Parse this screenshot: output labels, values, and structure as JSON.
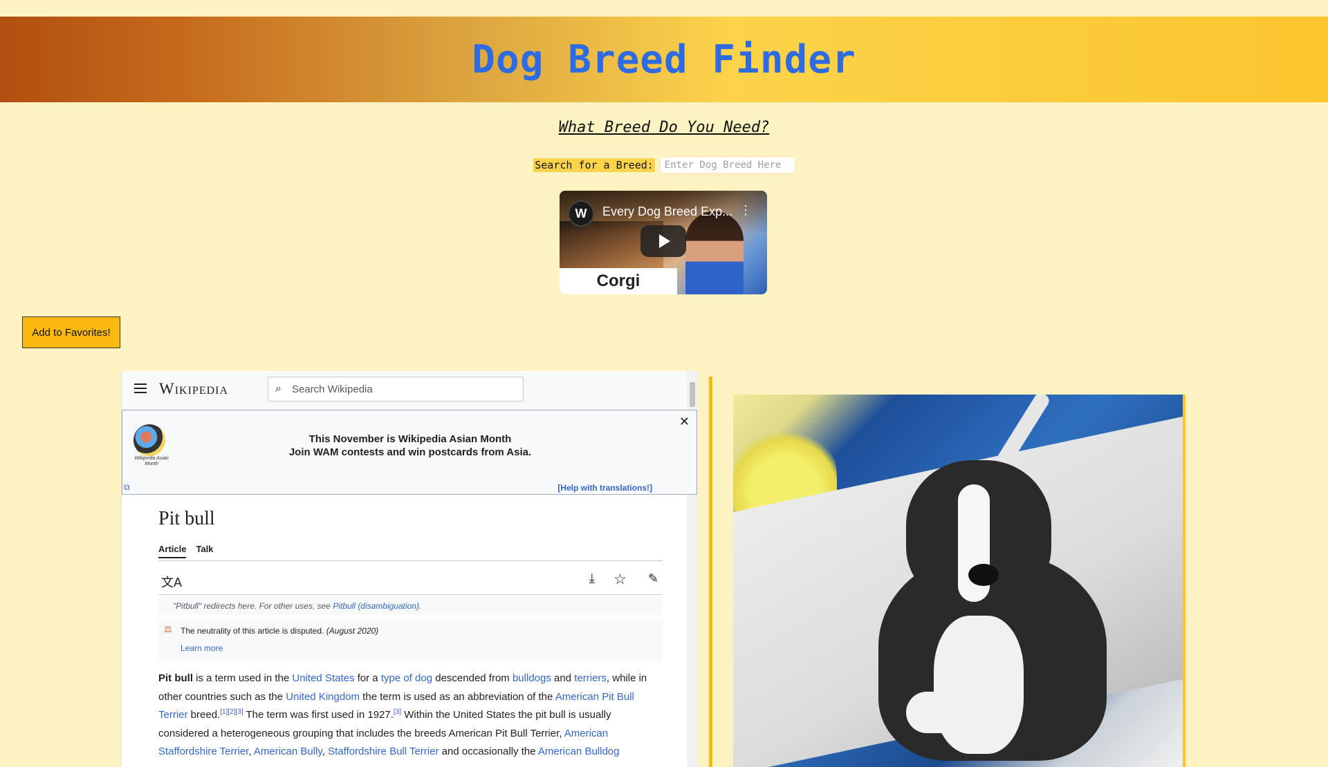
{
  "header": {
    "title": "Dog Breed Finder"
  },
  "subtitle": "What Breed Do You Need?",
  "search": {
    "label": "Search for a Breed:",
    "placeholder": "Enter Dog Breed Here",
    "value": ""
  },
  "video": {
    "title": "Every Dog Breed Exp...",
    "caption": "Corgi",
    "channel_initial": "W"
  },
  "favorites_button": "Add to Favorites!",
  "wiki": {
    "logo": "Wikipedia",
    "search_placeholder": "Search Wikipedia",
    "banner": {
      "line1": "This November is Wikipedia Asian Month",
      "line2": "Join WAM contests and win postcards from Asia.",
      "help": "[Help with translations!]",
      "logo_text": "Wikipedia Asian Month"
    },
    "article_title": "Pit bull",
    "tabs": [
      "Article",
      "Talk"
    ],
    "hatnote": {
      "prefix": "\"Pitbull\" redirects here. For other uses, see ",
      "link": "Pitbull (disambiguation)",
      "suffix": "."
    },
    "ambox": {
      "text": "The neutrality of this article is disputed.",
      "date": "(August 2020)",
      "learn_more": "Learn more"
    },
    "body": {
      "t1": "Pit bull",
      "t2": " is a term used in the ",
      "l1": "United States",
      "t3": " for a ",
      "l2": "type of dog",
      "t4": " descended from ",
      "l3": "bulldogs",
      "t5": " and ",
      "l4": "terriers",
      "t6": ", while in other countries such as the ",
      "l5": "United Kingdom",
      "t7": " the term is used as an abbreviation of the ",
      "l6": "American Pit Bull Terrier",
      "t8": " breed.",
      "s1": "[1][2][3]",
      "t9": " The term was first used in 1927.",
      "s2": "[3]",
      "t10": " Within the United States the pit bull is usually considered a heterogeneous grouping that includes the breeds American Pit Bull Terrier, ",
      "l7": "American Staffordshire Terrier",
      "t11": ", ",
      "l8": "American Bully",
      "t12": ", ",
      "l9": "Staffordshire Bull Terrier",
      "t13": " and occasionally the ",
      "l10": "American Bulldog"
    }
  },
  "colors": {
    "title": "#2e6be0",
    "background": "#fdf2c2",
    "button": "#fbb80f",
    "accent_bar": "#fbb80f"
  }
}
